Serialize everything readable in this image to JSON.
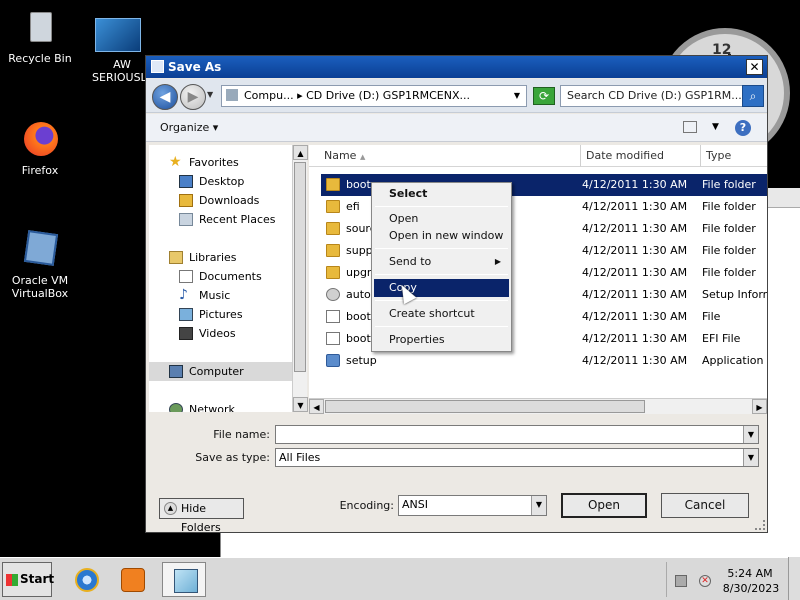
{
  "desktop": {
    "icons": [
      {
        "label": "Recycle Bin"
      },
      {
        "label": "Firefox"
      },
      {
        "label": "Oracle VM VirtualBox"
      }
    ],
    "aw_label_1": "AW",
    "aw_label_2": "SERIOUSLY",
    "clock_number": "12"
  },
  "dialog": {
    "title": "Save As",
    "close_label": "✕",
    "address": {
      "path": "Compu... ▸ CD Drive (D:) GSP1RMCENX...",
      "search_placeholder": "Search CD Drive (D:) GSP1RM..."
    },
    "toolbar": {
      "organize": "Organize"
    },
    "nav": {
      "items": [
        {
          "label": "Favorites"
        },
        {
          "label": "Desktop"
        },
        {
          "label": "Downloads"
        },
        {
          "label": "Recent Places"
        },
        {
          "label": "Libraries"
        },
        {
          "label": "Documents"
        },
        {
          "label": "Music"
        },
        {
          "label": "Pictures"
        },
        {
          "label": "Videos"
        },
        {
          "label": "Computer"
        },
        {
          "label": "Network"
        }
      ]
    },
    "columns": {
      "name": "Name",
      "date": "Date modified",
      "type": "Type"
    },
    "files": [
      {
        "name": "boot",
        "date": "4/12/2011 1:30 AM",
        "type": "File folder"
      },
      {
        "name": "efi",
        "date": "4/12/2011 1:30 AM",
        "type": "File folder"
      },
      {
        "name": "sourc",
        "date": "4/12/2011 1:30 AM",
        "type": "File folder"
      },
      {
        "name": "supp",
        "date": "4/12/2011 1:30 AM",
        "type": "File folder"
      },
      {
        "name": "upgra",
        "date": "4/12/2011 1:30 AM",
        "type": "File folder"
      },
      {
        "name": "autor",
        "date": "4/12/2011 1:30 AM",
        "type": "Setup Inform"
      },
      {
        "name": "bootr",
        "date": "4/12/2011 1:30 AM",
        "type": "File"
      },
      {
        "name": "bootr",
        "date": "4/12/2011 1:30 AM",
        "type": "EFI File"
      },
      {
        "name": "setup",
        "date": "4/12/2011 1:30 AM",
        "type": "Application"
      }
    ],
    "form": {
      "file_name_label": "File name:",
      "file_name_value": "",
      "save_type_label": "Save as type:",
      "save_type_value": "All Files",
      "encoding_label": "Encoding:",
      "encoding_value": "ANSI",
      "hide_folders": "Hide Folders",
      "open": "Open",
      "cancel": "Cancel"
    }
  },
  "context_menu": {
    "items": [
      "Select",
      "Open",
      "Open in new window",
      "Send to",
      "Copy",
      "Create shortcut",
      "Properties"
    ]
  },
  "taskbar": {
    "start": "Start",
    "time": "5:24 AM",
    "date": "8/30/2023"
  }
}
